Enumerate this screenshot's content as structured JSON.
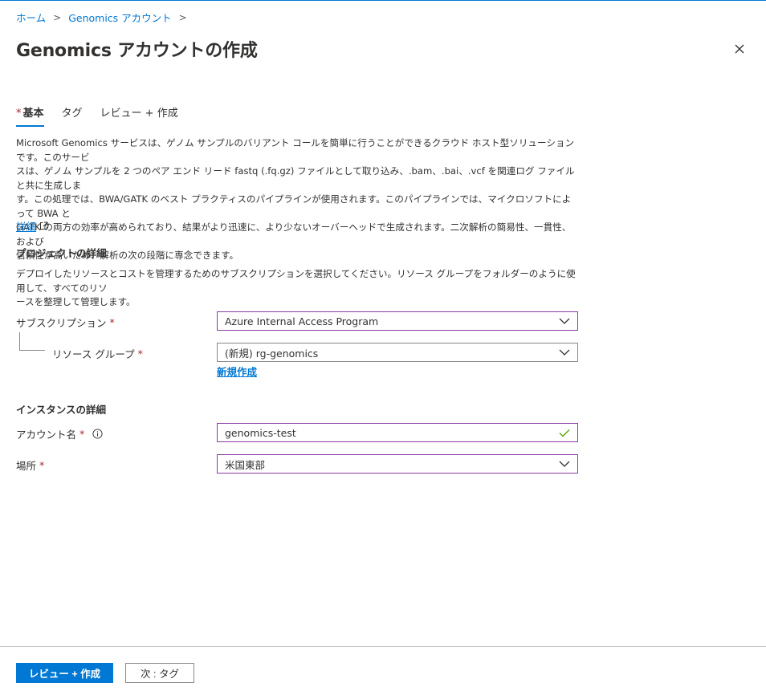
{
  "breadcrumb": {
    "items": [
      "ホーム",
      "Genomics アカウント"
    ],
    "separator": ">"
  },
  "page": {
    "title": "Genomics アカウントの作成",
    "close_icon": "close-icon"
  },
  "tabs": [
    {
      "label": "基本",
      "required_marker": "*",
      "active": true
    },
    {
      "label": "タグ",
      "active": false
    },
    {
      "label": "レビュー + 作成",
      "active": false
    }
  ],
  "description": {
    "lines": [
      "Microsoft Genomics サービスは、ゲノム サンプルのバリアント コールを簡単に行うことができるクラウド ホスト型ソリューションです。このサービ",
      "スは、ゲノム サンプルを 2 つのペア エンド リード fastq (.fq.gz) ファイルとして取り込み、.bam、.bai、.vcf を関連ログ ファイルと共に生成しま",
      "す。この処理では、BWA/GATK のベスト プラクティスのパイプラインが使用されます。このパイプラインでは、マイクロソフトによって BWA と",
      "GATK の両方の効率が高められており、結果がより迅速に、より少ないオーバーヘッドで生成されます。二次解析の簡易性、一貫性、および",
      "信頼性が高いため、解析の次の段階に専念できます。"
    ],
    "learn_more": "詳細",
    "learn_more_icon": "external-link-icon"
  },
  "project_details": {
    "title": "プロジェクトの詳細",
    "lines": [
      "デプロイしたリソースとコストを管理するためのサブスクリプションを選択してください。リソース グループをフォルダーのように使用して、すべてのリソ",
      "ースを整理して管理します。"
    ],
    "subscription_label": "サブスクリプション",
    "subscription_value": "Azure Internal Access Program",
    "resource_group_label": "リソース グループ",
    "resource_group_value": "(新規) rg-genomics",
    "create_new": "新規作成"
  },
  "instance_details": {
    "title": "インスタンスの詳細",
    "account_name_label": "アカウント名",
    "account_name_value": "genomics-test",
    "location_label": "場所",
    "location_value": "米国東部"
  },
  "required_marker": "*",
  "footer": {
    "review_create": "レビュー + 作成",
    "next": "次 : タグ"
  },
  "colors": {
    "accent": "#0078d4",
    "required": "#a4262c",
    "field_border": "#8a3ca0",
    "valid": "#57a300"
  }
}
